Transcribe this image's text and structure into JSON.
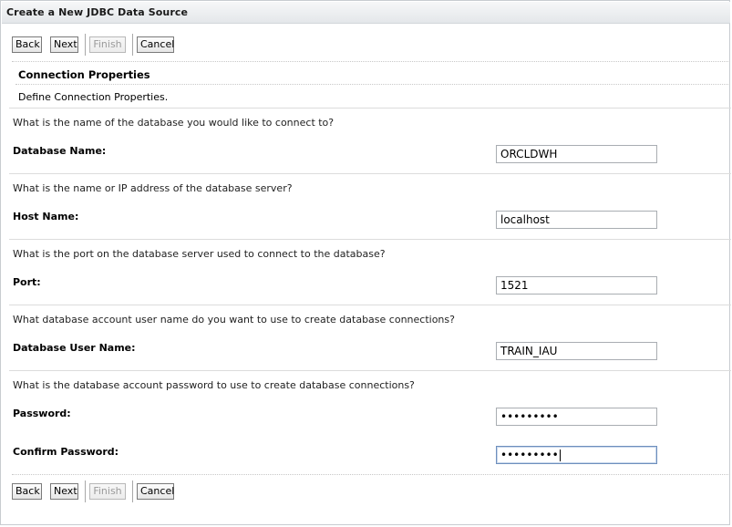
{
  "window": {
    "title": "Create a New JDBC Data Source"
  },
  "toolbar": {
    "back_label": "Back",
    "next_label": "Next",
    "finish_label": "Finish",
    "cancel_label": "Cancel",
    "finish_disabled": true
  },
  "section": {
    "title": "Connection Properties",
    "description": "Define Connection Properties."
  },
  "fields": {
    "database_name": {
      "question": "What is the name of the database you would like to connect to?",
      "label": "Database Name:",
      "value": "ORCLDWH"
    },
    "host_name": {
      "question": "What is the name or IP address of the database server?",
      "label": "Host Name:",
      "value": "localhost"
    },
    "port": {
      "question": "What is the port on the database server used to connect to the database?",
      "label": "Port:",
      "value": "1521"
    },
    "user_name": {
      "question": "What database account user name do you want to use to create database connections?",
      "label": "Database User Name:",
      "value": "TRAIN_IAU"
    },
    "password": {
      "question": "What is the database account password to use to create database connections?",
      "label": "Password:",
      "masked_value": "•••••••••"
    },
    "confirm_password": {
      "label": "Confirm Password:",
      "masked_value": "•••••••••"
    }
  },
  "colors": {
    "title_bar_top": "#f6f7f8",
    "title_bar_bottom": "#e4e7ea",
    "field_border": "#a9adb2",
    "focused_border": "#6e8fbd",
    "disabled_text": "#9a9a9a"
  }
}
